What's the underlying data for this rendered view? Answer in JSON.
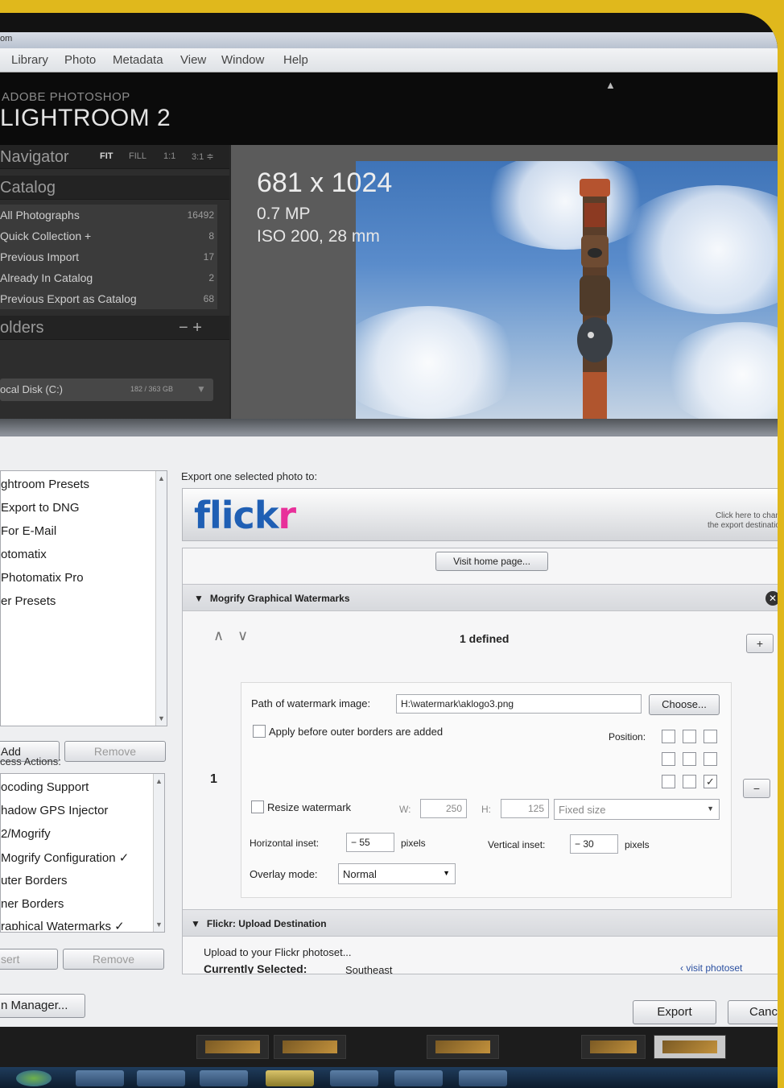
{
  "window": {
    "title": "om"
  },
  "menu": [
    "Library",
    "Photo",
    "Metadata",
    "View",
    "Window",
    "Help"
  ],
  "app": {
    "brand_small": "ADOBE PHOTOSHOP",
    "brand_big": "LIGHTROOM 2"
  },
  "navigator": {
    "title": "Navigator",
    "zoom": [
      "FIT",
      "FILL",
      "1:1",
      "3:1 ≑"
    ]
  },
  "catalog": {
    "title": "Catalog",
    "items": [
      {
        "label": "All Photographs",
        "count": "16492"
      },
      {
        "label": "Quick Collection +",
        "count": "8"
      },
      {
        "label": "Previous Import",
        "count": "17"
      },
      {
        "label": "Already In Catalog",
        "count": "2"
      },
      {
        "label": "Previous Export as Catalog",
        "count": "68"
      }
    ]
  },
  "folders": {
    "title": "olders",
    "controls": "− +",
    "disk_label": "ocal Disk (C:)",
    "disk_size": "182 / 363 GB"
  },
  "preview_info": {
    "dims": "681 x 1024",
    "mp": "0.7 MP",
    "iso": "ISO 200, 28 mm"
  },
  "dialog": {
    "presets": [
      "ghtroom Presets",
      "Export to DNG",
      "For E-Mail",
      "otomatix",
      "Photomatix Pro",
      "er Presets"
    ],
    "add_label": "Add",
    "remove_label": "Remove",
    "post_actions_label": "cess Actions:",
    "post_actions": [
      "ocoding Support",
      "hadow GPS Injector",
      "2/Mogrify",
      "Mogrify Configuration",
      "uter Borders",
      "ner Borders",
      "raphical Watermarks"
    ],
    "checkmark": "✓",
    "insert_label": "sert",
    "remove2_label": "Remove",
    "manager_label": "n Manager...",
    "export_to_label": "Export one selected photo to:",
    "flickr": {
      "fl": "flick",
      "r": "r",
      "hint_1": "Click here to chan",
      "hint_here": "here",
      "hint_2": "the export destinatio"
    },
    "visit_home": "Visit home page...",
    "wm_section_title": "Mogrify Graphical Watermarks",
    "defined": "1 defined",
    "wm_index": "1",
    "path_label": "Path of watermark image:",
    "path_value": "H:\\watermark\\aklogo3.png",
    "choose_label": "Choose...",
    "apply_before_label": "Apply before outer borders are added",
    "position_label": "Position:",
    "position_check": "✓",
    "resize_label": "Resize watermark",
    "w_label": "W:",
    "w_value": "250",
    "h_label": "H:",
    "h_value": "125",
    "fixed_size": "Fixed size",
    "hinset_label": "Horizontal inset:",
    "hinset_value": "− 55",
    "pixels": "pixels",
    "vinset_label": "Vertical inset:",
    "vinset_value": "− 30",
    "overlay_label": "Overlay mode:",
    "overlay_value": "Normal",
    "plus": "+",
    "minus": "−",
    "upload_section_title": "Flickr: Upload Destination",
    "upload_text": "Upload to your Flickr photoset...",
    "currently_selected_label": "Currently Selected:",
    "currently_selected_value": "Southeast",
    "visit_photoset": "visit photoset",
    "export_label": "Export",
    "cancel_label": "Canc"
  }
}
